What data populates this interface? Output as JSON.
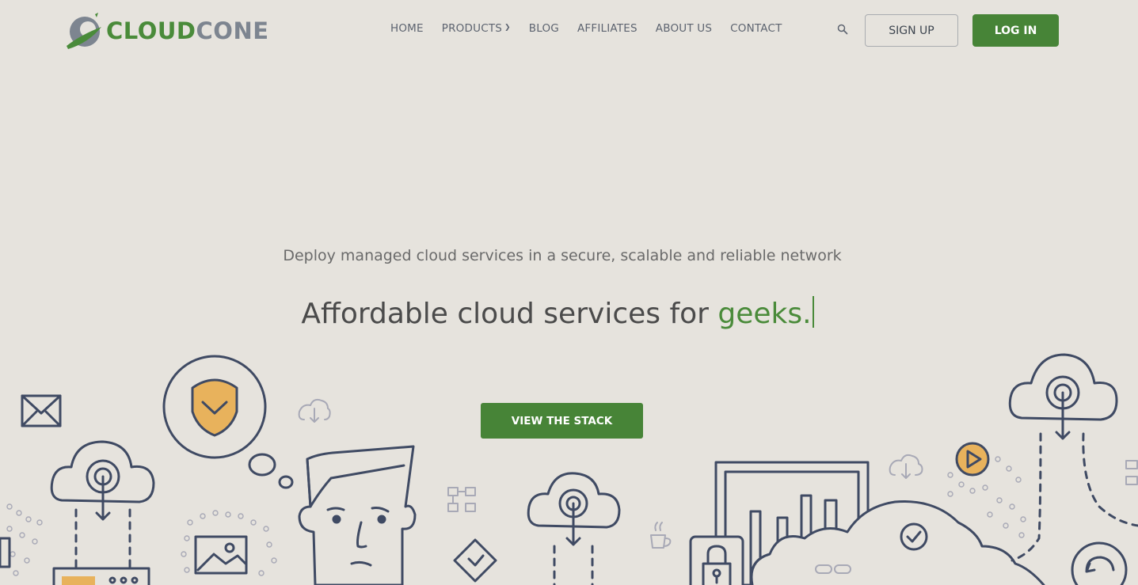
{
  "brand": {
    "name_part1": "CLOUD",
    "name_part2": "CONE",
    "colors": {
      "accent": "#478437",
      "text_gray": "#7d8590",
      "background": "#e6e3dd",
      "highlight": "#e8b25c"
    }
  },
  "nav": {
    "items": [
      {
        "label": "HOME"
      },
      {
        "label": "PRODUCTS",
        "has_dropdown": true
      },
      {
        "label": "BLOG"
      },
      {
        "label": "AFFILIATES"
      },
      {
        "label": "ABOUT US"
      },
      {
        "label": "CONTACT"
      }
    ],
    "search_icon": "search-icon",
    "signup_label": "SIGN UP",
    "login_label": "LOG IN"
  },
  "hero": {
    "subtitle": "Deploy managed cloud services in a secure, scalable and reliable network",
    "headline_prefix": "Affordable cloud services for ",
    "headline_accent": "geeks.",
    "cta_label": "VIEW THE STACK"
  }
}
